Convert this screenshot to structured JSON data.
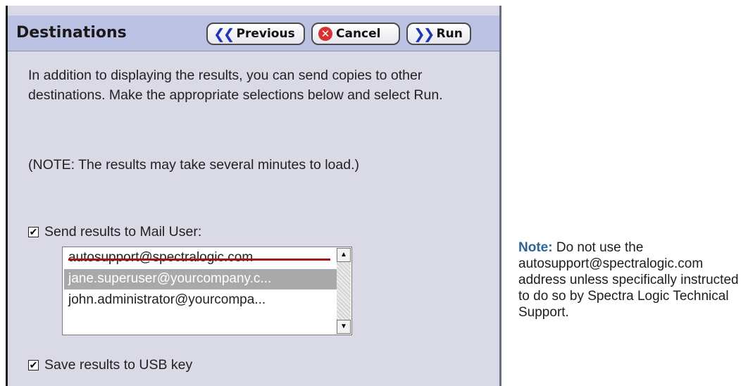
{
  "dialog": {
    "title": "Destinations",
    "buttons": {
      "previous": "Previous",
      "cancel": "Cancel",
      "run": "Run"
    },
    "intro_text": "In addition to displaying the results, you can send copies to other destinations. Make the appropriate selections below and select Run.",
    "load_note": "(NOTE: The results may take several minutes to load.)",
    "mail_option": {
      "label": "Send results to Mail User:",
      "checked": true
    },
    "mail_users": [
      {
        "email": "autosupport@spectralogic.com",
        "struck_through": true,
        "selected": false
      },
      {
        "email": "jane.superuser@yourcompany.c...",
        "selected": true
      },
      {
        "email": "john.administrator@yourcompa...",
        "selected": false
      }
    ],
    "usb_option": {
      "label": "Save results to USB key",
      "checked": true
    }
  },
  "side_note": {
    "label": "Note:",
    "text": "Do not use the autosupport@spectralogic.com address unless specifically instructed to do so by Spectra Logic Technical Support."
  },
  "colors": {
    "header_bg": "#bcc2e4",
    "panel_bg": "#d9dae6",
    "selected_row": "#a9a9a9",
    "strike_line": "#a3171a",
    "note_label": "#2f6496"
  }
}
